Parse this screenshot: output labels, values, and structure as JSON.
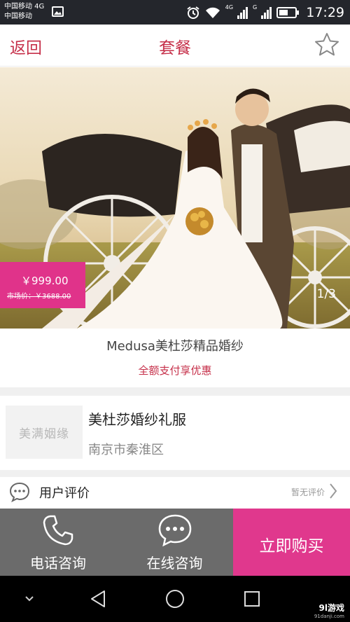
{
  "status_bar": {
    "carrier_1": "中国移动 4G",
    "carrier_2": "中国移动",
    "net_4g": "4G",
    "net_g": "G",
    "time": "17:29"
  },
  "header": {
    "back_label": "返回",
    "title": "套餐",
    "favorite_icon": "star-outline-icon"
  },
  "hero": {
    "price": "￥999.00",
    "market_price": "市场价：￥3688.00",
    "pager": "1/3"
  },
  "product": {
    "name": "Medusa美杜莎精品婚纱",
    "promo": "全额支付享优惠"
  },
  "store": {
    "logo_text": "美满姻缘",
    "name": "美杜莎婚纱礼服",
    "location": "南京市秦淮区"
  },
  "reviews": {
    "label": "用户评价",
    "status": "暂无评价"
  },
  "actions": {
    "phone_label": "电话咨询",
    "chat_label": "在线咨询",
    "buy_label": "立即购买"
  },
  "watermark": {
    "brand": "9l游戏",
    "site": "91danji.com"
  },
  "colors": {
    "accent_red": "#c6304a",
    "pink": "#e0338a",
    "action_gray": "#6b6b6b"
  }
}
